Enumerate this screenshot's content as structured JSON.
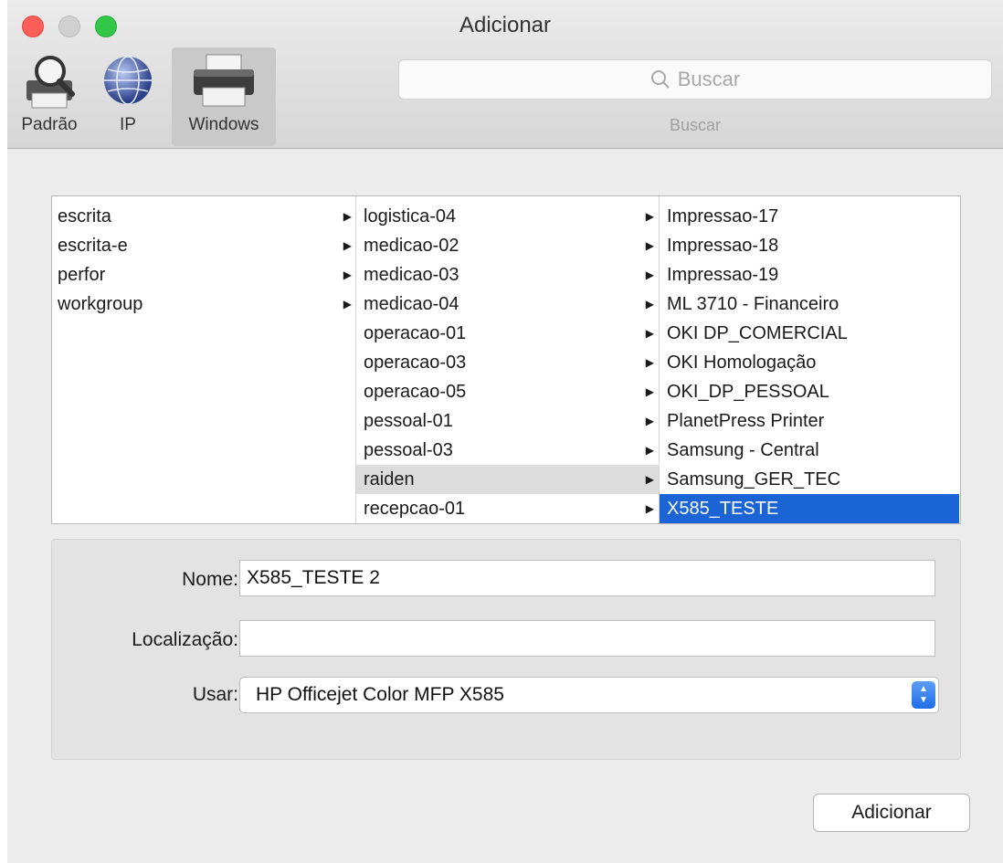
{
  "window": {
    "title": "Adicionar"
  },
  "toolbar": {
    "tabs": [
      {
        "label": "Padrão",
        "icon": "printer-magnifier-icon"
      },
      {
        "label": "IP",
        "icon": "globe-icon"
      },
      {
        "label": "Windows",
        "icon": "printer-icon",
        "selected": true
      }
    ],
    "search_placeholder": "Buscar",
    "search_caption": "Buscar"
  },
  "browser": {
    "column1": [
      "escrita",
      "escrita-e",
      "perfor",
      "workgroup"
    ],
    "column2": [
      "logistica-04",
      "medicao-02",
      "medicao-03",
      "medicao-04",
      "operacao-01",
      "operacao-03",
      "operacao-05",
      "pessoal-01",
      "pessoal-03",
      "raiden",
      "recepcao-01"
    ],
    "column2_selected": "raiden",
    "column3": [
      "Impressao-17",
      "Impressao-18",
      "Impressao-19",
      "ML 3710 - Financeiro",
      "OKI DP_COMERCIAL",
      "OKI Homologação",
      "OKI_DP_PESSOAL",
      "PlanetPress Printer",
      "Samsung - Central",
      "Samsung_GER_TEC",
      "X585_TESTE"
    ],
    "column3_selected": "X585_TESTE"
  },
  "form": {
    "nome_label": "Nome:",
    "nome_value": "X585_TESTE 2",
    "localizacao_label": "Localização:",
    "localizacao_value": "",
    "usar_label": "Usar:",
    "usar_value": "HP Officejet Color MFP X585"
  },
  "buttons": {
    "add_label": "Adicionar"
  },
  "colors": {
    "selection_blue": "#1a64d6",
    "selection_gray": "#dcdcdc"
  }
}
